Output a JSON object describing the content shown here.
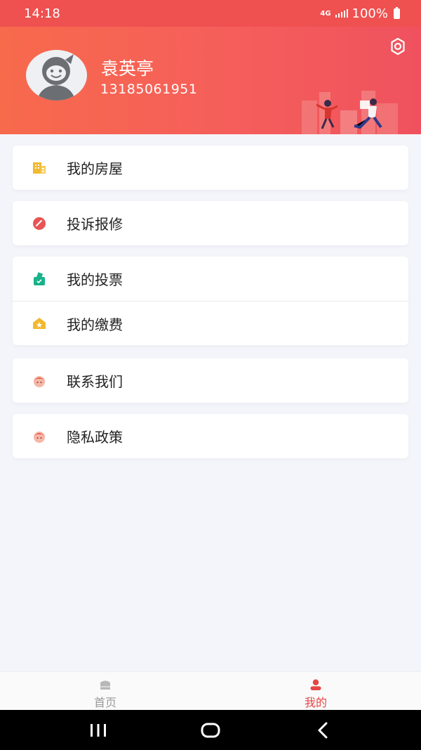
{
  "status_bar": {
    "time": "14:18",
    "network": "4G",
    "battery": "100%"
  },
  "header": {
    "user_name": "袁英亭",
    "phone": "13185061951",
    "avatar_icon": "default-avatar",
    "settings_icon": "gear-icon",
    "colors": {
      "gradient_start": "#f76a4c",
      "gradient_end": "#ef525e"
    }
  },
  "menu_groups": [
    [
      {
        "label": "我的房屋",
        "icon": "building-icon",
        "color": "#f2b82f"
      }
    ],
    [
      {
        "label": "投诉报修",
        "icon": "wrench-icon",
        "color": "#e85454"
      }
    ],
    [
      {
        "label": "我的投票",
        "icon": "vote-icon",
        "color": "#19b28a"
      },
      {
        "label": "我的缴费",
        "icon": "payment-icon",
        "color": "#f2b82f"
      }
    ],
    [
      {
        "label": "联系我们",
        "icon": "contact-icon",
        "color": "#f0705a"
      }
    ],
    [
      {
        "label": "隐私政策",
        "icon": "privacy-icon",
        "color": "#f0705a"
      }
    ]
  ],
  "tab_bar": {
    "home_label": "首页",
    "mine_label": "我的",
    "active": "mine",
    "active_color": "#e64545",
    "inactive_color": "#999999"
  },
  "nav_bar": {
    "recent_icon": "recent-apps-icon",
    "home_icon": "home-nav-icon",
    "back_icon": "back-icon"
  }
}
